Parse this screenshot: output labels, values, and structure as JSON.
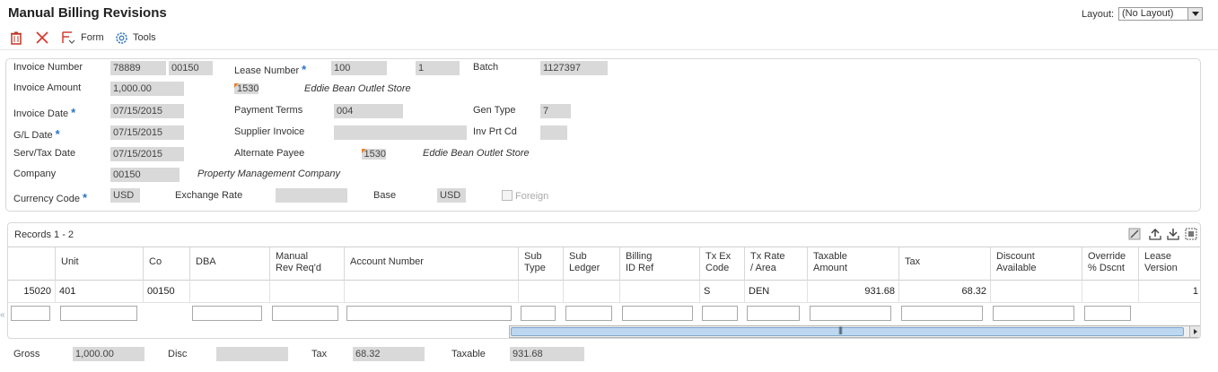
{
  "title": "Manual Billing Revisions",
  "layout": {
    "label": "Layout:",
    "value": "(No Layout)"
  },
  "toolbar": {
    "form_label": "Form",
    "tools_label": "Tools"
  },
  "header": {
    "invoice_number_label": "Invoice Number",
    "invoice_number": "78889",
    "invoice_company": "00150",
    "lease_number_label": "Lease Number",
    "lease_number": "100",
    "lease_version": "1",
    "batch_label": "Batch",
    "batch": "1127397",
    "invoice_amount_label": "Invoice Amount",
    "invoice_amount": "1,000.00",
    "tenant_number": "1530",
    "tenant_name": "Eddie Bean Outlet Store",
    "invoice_date_label": "Invoice Date",
    "invoice_date": "07/15/2015",
    "payment_terms_label": "Payment Terms",
    "payment_terms": "004",
    "gen_type_label": "Gen Type",
    "gen_type": "7",
    "gl_date_label": "G/L Date",
    "gl_date": "07/15/2015",
    "supplier_invoice_label": "Supplier Invoice",
    "supplier_invoice": "",
    "inv_prt_cd_label": "Inv Prt Cd",
    "inv_prt_cd": "",
    "serv_tax_date_label": "Serv/Tax Date",
    "serv_tax_date": "07/15/2015",
    "alternate_payee_label": "Alternate Payee",
    "alternate_payee": "1530",
    "alternate_payee_name": "Eddie Bean Outlet Store",
    "company_label": "Company",
    "company": "00150",
    "company_name": "Property Management Company",
    "currency_code_label": "Currency Code",
    "currency_code": "USD",
    "exchange_rate_label": "Exchange Rate",
    "exchange_rate": "",
    "base_label": "Base",
    "base": "USD",
    "foreign_label": "Foreign"
  },
  "grid": {
    "records_label": "Records 1 - 2",
    "columns": [
      {
        "l1": "",
        "l2": ""
      },
      {
        "l1": "Unit",
        "l2": ""
      },
      {
        "l1": "Co",
        "l2": ""
      },
      {
        "l1": "DBA",
        "l2": ""
      },
      {
        "l1": "Manual",
        "l2": "Rev Req'd"
      },
      {
        "l1": "Account Number",
        "l2": ""
      },
      {
        "l1": "Sub",
        "l2": "Type"
      },
      {
        "l1": "Sub",
        "l2": "Ledger"
      },
      {
        "l1": "Billing",
        "l2": "ID Ref"
      },
      {
        "l1": "Tx Ex",
        "l2": "Code"
      },
      {
        "l1": "Tx Rate",
        "l2": "/ Area"
      },
      {
        "l1": "Taxable",
        "l2": "Amount"
      },
      {
        "l1": "Tax",
        "l2": ""
      },
      {
        "l1": "Discount",
        "l2": "Available"
      },
      {
        "l1": "Override",
        "l2": "% Dscnt"
      },
      {
        "l1": "Lease",
        "l2": "Version"
      }
    ],
    "rows": [
      [
        "15020",
        "401",
        "00150",
        "",
        "",
        "",
        "",
        "",
        "",
        "S",
        "DEN",
        "931.68",
        "68.32",
        "",
        "",
        "1"
      ]
    ]
  },
  "footer": {
    "gross_label": "Gross",
    "gross": "1,000.00",
    "disc_label": "Disc",
    "disc": "",
    "tax_label": "Tax",
    "tax": "68.32",
    "taxable_label": "Taxable",
    "taxable": "931.68"
  }
}
